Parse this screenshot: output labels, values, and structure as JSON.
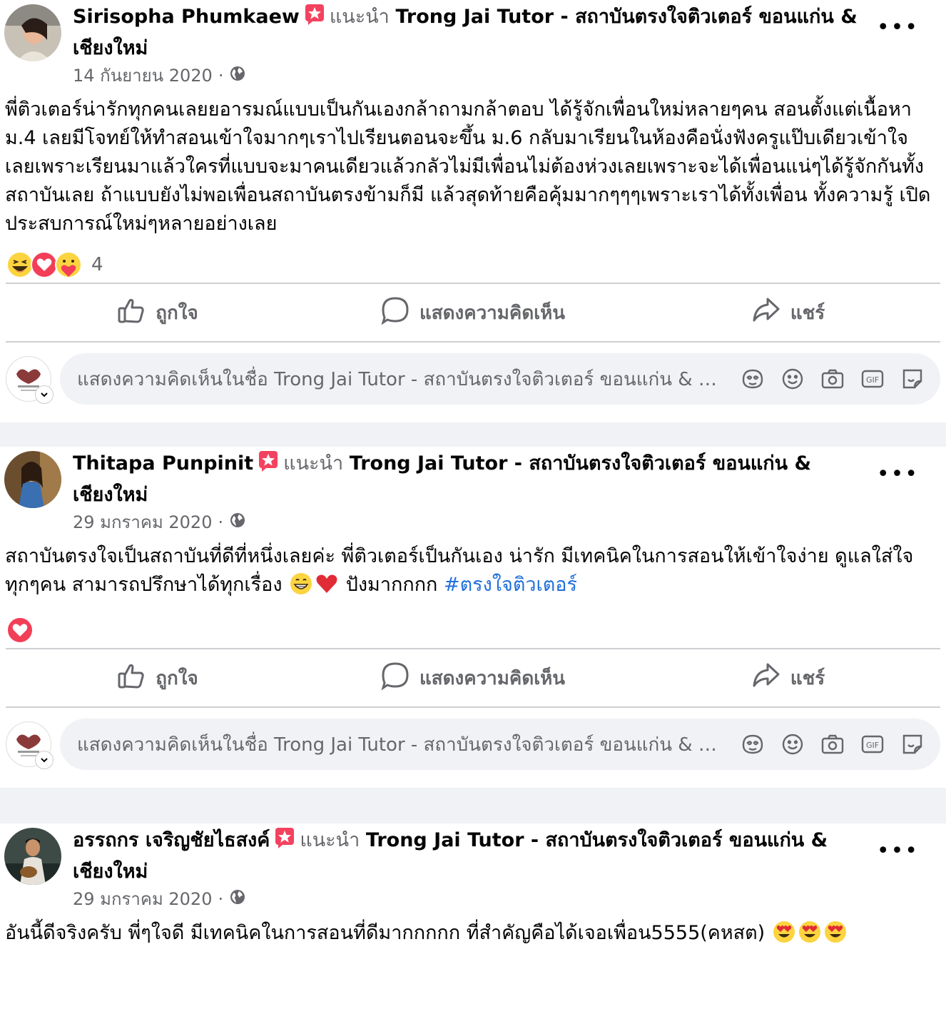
{
  "posts": [
    {
      "author": "Sirisopha Phumkaew",
      "recommend_label": "แนะนำ",
      "page_name": "Trong Jai Tutor - สถาบันตรงใจติวเตอร์ ขอนแก่น & เชียงใหม่",
      "date": "14 กันยายน 2020",
      "body": "พี่ติวเตอร์น่ารักทุกคนเลยยอารมณ์แบบเป็นกันเองกล้าถามกล้าตอบ ได้รู้จักเพื่อนใหม่หลายๆคน สอนตั้งแต่เนื้อหา ม.4 เลยมีโจทย์ให้ทำสอนเข้าใจมากๆเราไปเรียนตอนจะขึ้น ม.6 กลับมาเรียนในห้องคือนั่งฟังครูแป๊บเดียวเข้าใจเลยเพราะเรียนมาแล้วใครที่แบบจะมาคนเดียวแล้วกลัวไม่มีเพื่อนไม่ต้องห่วงเลยเพราะจะได้เพื่อนแน่ๆได้รู้จักกันทั้งสถาบันเลย ถ้าแบบยังไม่พอเพื่อนสถาบันตรงข้ามก็มี แล้วสุดท้ายคือคุ้มมากๆๆๆเพราะเราได้ทั้งเพื่อน ทั้งความรู้ เปิดประสบการณ์ใหม่ๆหลายอย่างเลย",
      "reactions": [
        "haha-icon",
        "love-icon",
        "care-icon"
      ],
      "reaction_count": "4"
    },
    {
      "author": "Thitapa Punpinit",
      "recommend_label": "แนะนำ",
      "page_name": "Trong Jai Tutor - สถาบันตรงใจติวเตอร์ ขอนแก่น & เชียงใหม่",
      "date": "29 มกราคม 2020",
      "body_prefix": "สถาบันตรงใจเป็นสถาบันที่ดีที่หนึ่งเลยค่ะ พี่ติวเตอร์เป็นกันเอง น่ารัก มีเทคนิคในการสอนให้เข้าใจง่าย ดูแลใส่ใจทุกๆคน สามารถปรึกษาได้ทุกเรื่อง",
      "body_suffix": "ปังมากกกก",
      "hashtag": "#ตรงใจติวเตอร์",
      "reactions": [
        "love-icon"
      ]
    },
    {
      "author": "อรรถกร เจริญชัยไธสงค์",
      "recommend_label": "แนะนำ",
      "page_name": "Trong Jai Tutor - สถาบันตรงใจติวเตอร์ ขอนแก่น & เชียงใหม่",
      "date": "29 มกราคม 2020",
      "body": "อันนี้ดีจริงครับ พี่ๆใจดี มีเทคนิคในการสอนที่ดีมากกกกก ที่สำคัญคือได้เจอเพื่อน5555(คหสต)"
    }
  ],
  "actions": {
    "like": "ถูกใจ",
    "comment": "แสดงความคิดเห็น",
    "share": "แชร์"
  },
  "comment_placeholder": "แสดงความคิดเห็นในชื่อ Trong Jai Tutor - สถาบันตรงใจติวเตอร์ ขอนแก่น & เชียงใหม่",
  "colors": {
    "badge": "#f3425f",
    "link": "#216fdb",
    "secondary_text": "#65676b"
  }
}
